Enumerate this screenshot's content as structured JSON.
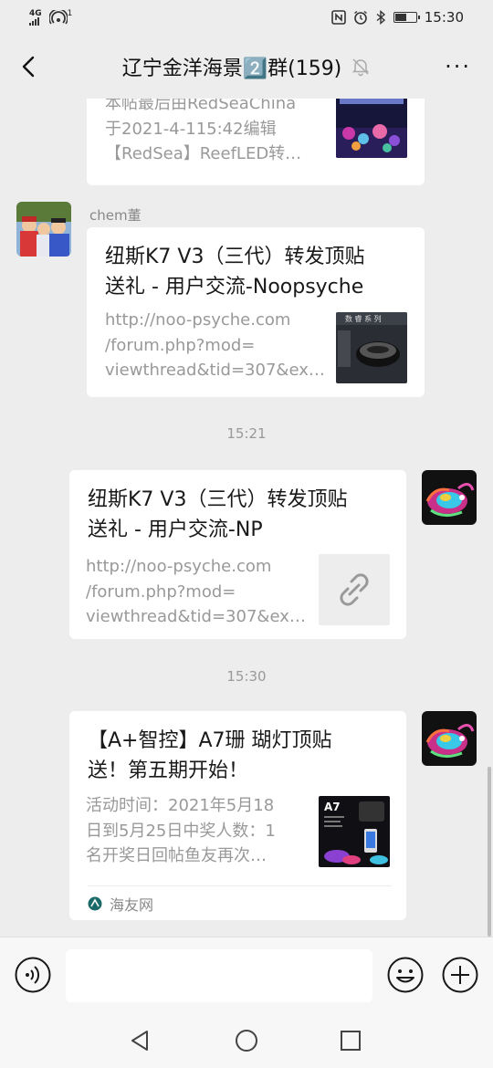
{
  "status": {
    "net_top": "4G",
    "net_bottom": "",
    "hotspot_badge": "1",
    "time": "15:30",
    "battery_level": 0.6
  },
  "header": {
    "title": "辽宁金洋海景2️⃣群(159)",
    "more_label": "···"
  },
  "messages": [
    {
      "desc_lines": [
        "本帖最后由RedSeaChina",
        "于2021-4-115:42编辑",
        "【RedSea】ReefLED转…"
      ]
    },
    {
      "sender": "chem董",
      "title_lines": [
        "纽斯K7 V3（三代）转发顶贴",
        "送礼 - 用户交流-Noopsyche"
      ],
      "desc_lines": [
        "http://noo-psyche.com",
        "/forum.php?mod=",
        "viewthread&tid=307&ex…"
      ],
      "thumb_text": "数 睿 系 列"
    },
    {
      "time": "15:21",
      "title_lines": [
        "纽斯K7 V3（三代）转发顶贴",
        "送礼 - 用户交流-NP"
      ],
      "desc_lines": [
        "http://noo-psyche.com",
        "/forum.php?mod=",
        "viewthread&tid=307&ex…"
      ]
    },
    {
      "time": "15:30",
      "title_lines": [
        "【A+智控】A7珊 瑚灯顶贴",
        "送！第五期开始！"
      ],
      "desc_lines": [
        "活动时间：2021年5月18",
        "日到5月25日中奖人数：1",
        "名开奖日回帖鱼友再次…"
      ],
      "thumb_text": "A7",
      "source": "海友网"
    }
  ],
  "colors": {
    "background": "#ededed",
    "card": "#ffffff",
    "muted_text": "#999999"
  }
}
